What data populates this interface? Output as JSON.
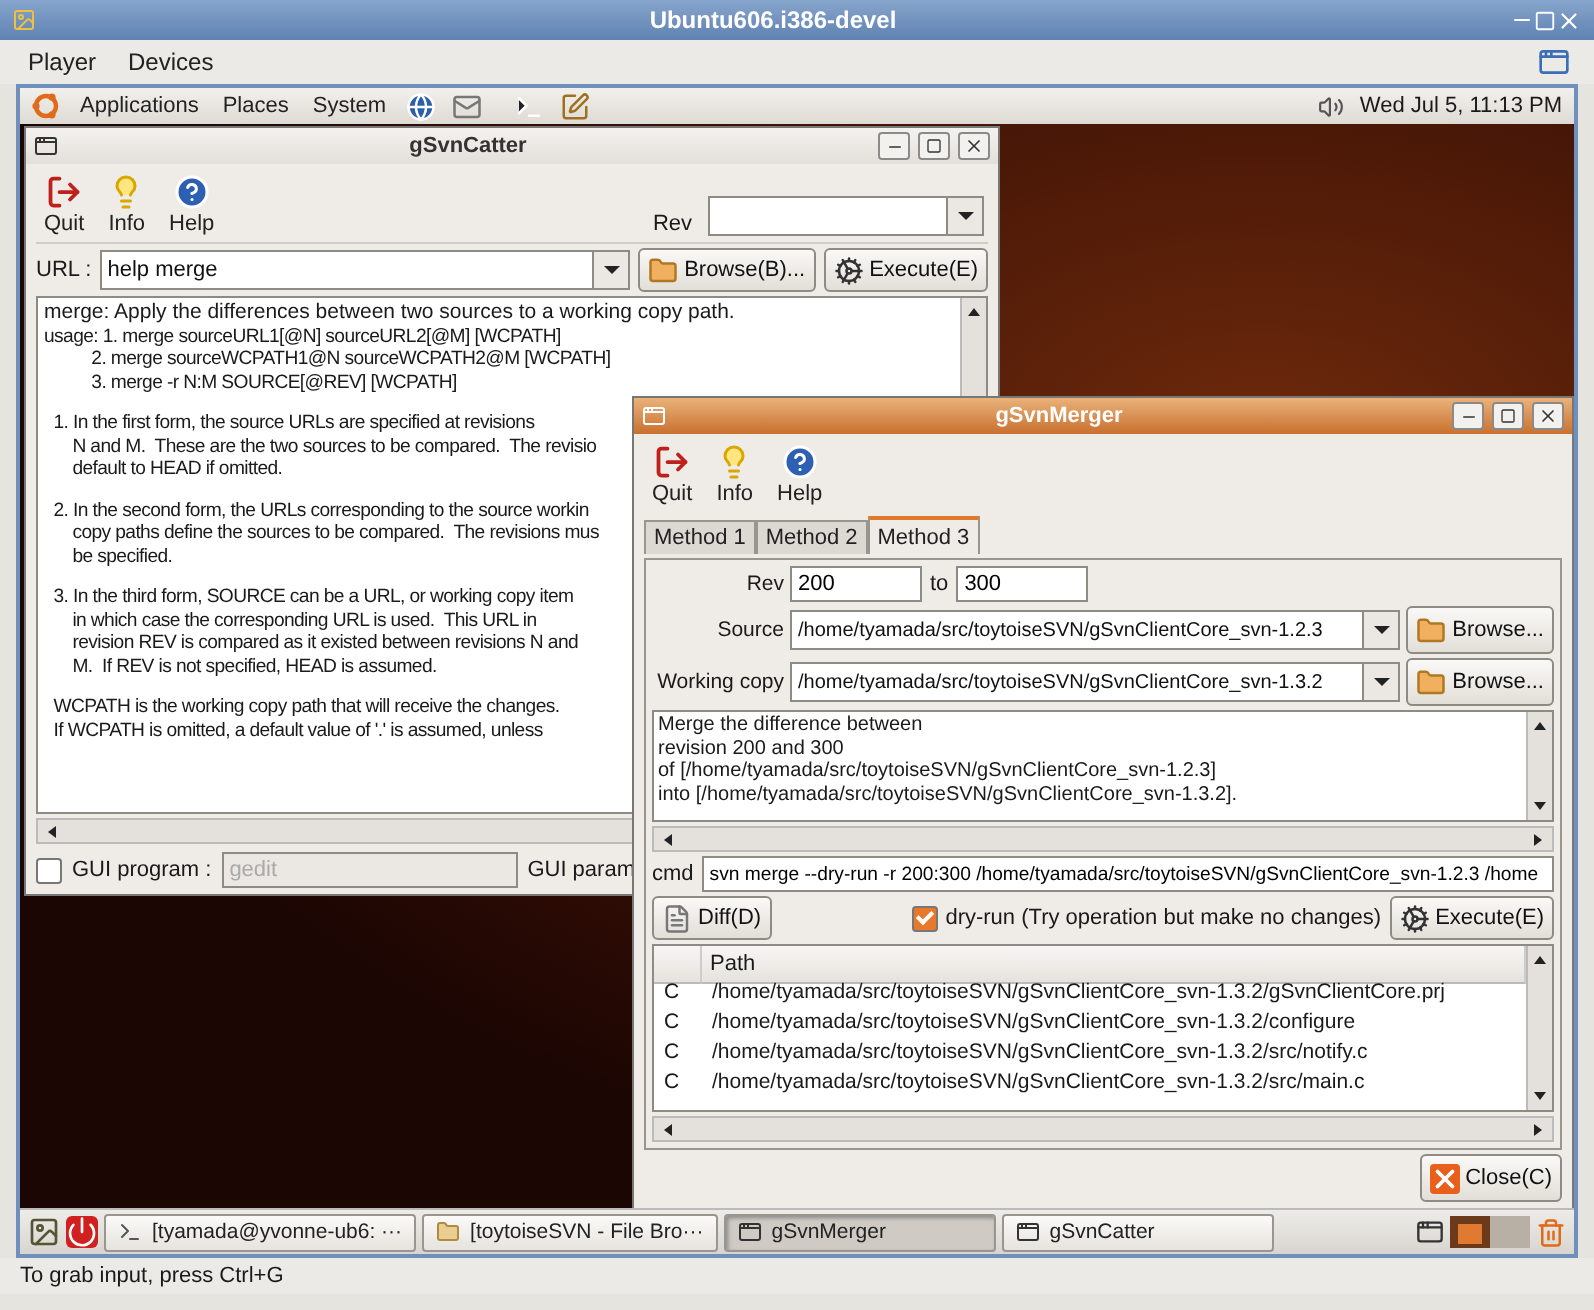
{
  "host": {
    "title": "Ubuntu606.i386-devel",
    "menus": [
      "Player",
      "Devices"
    ],
    "status": "To grab input, press Ctrl+G"
  },
  "top_panel": {
    "menus": [
      "Applications",
      "Places",
      "System"
    ],
    "clock": "Wed Jul  5, 11:13 PM"
  },
  "catter": {
    "title": "gSvnCatter",
    "focused": false,
    "toolbar": [
      {
        "kind": "quit",
        "label": "Quit"
      },
      {
        "kind": "info",
        "label": "Info"
      },
      {
        "kind": "help",
        "label": "Help"
      }
    ],
    "rev_label": "Rev",
    "url_label": "URL :",
    "url": "help merge",
    "browse": "Browse(B)...",
    "execute": "Execute(E)",
    "output": [
      [
        "merge: Apply the differences between two sources to a working copy path.",
        "usage: 1. merge sourceURL1[@N] sourceURL2[@M] [WCPATH]",
        "          2. merge sourceWCPATH1@N sourceWCPATH2@M [WCPATH]",
        "          3. merge -r N:M SOURCE[@REV] [WCPATH]"
      ],
      [
        "  1. In the first form, the source URLs are specified at revisions",
        "      N and M.  These are the two sources to be compared.  The revisio",
        "      default to HEAD if omitted."
      ],
      [
        "  2. In the second form, the URLs corresponding to the source workin",
        "      copy paths define the sources to be compared.  The revisions mus",
        "      be specified."
      ],
      [
        "  3. In the third form, SOURCE can be a URL, or working copy item",
        "      in which case the corresponding URL is used.  This URL in",
        "      revision REV is compared as it existed between revisions N and",
        "      M.  If REV is not specified, HEAD is assumed."
      ],
      [
        "  WCPATH is the working copy path that will receive the changes.",
        "  If WCPATH is omitted, a default value of '.' is assumed, unless"
      ]
    ],
    "gui_program": {
      "checked": false,
      "label": "GUI program :",
      "value": "gedit",
      "disabled": true
    },
    "gui_param": "GUI param"
  },
  "merger": {
    "title": "gSvnMerger",
    "focused": true,
    "toolbar": [
      {
        "kind": "quit",
        "label": "Quit"
      },
      {
        "kind": "info",
        "label": "Info"
      },
      {
        "kind": "help",
        "label": "Help"
      }
    ],
    "tabs": [
      {
        "label": "Method 1",
        "selected": false
      },
      {
        "label": "Method 2",
        "selected": false
      },
      {
        "label": "Method 3",
        "selected": true
      }
    ],
    "rev_label": "Rev",
    "rev_from": "200",
    "to_label": "to",
    "rev_to": "300",
    "source_label": "Source",
    "source": "/home/tyamada/src/toytoiseSVN/gSvnClientCore_svn-1.2.3",
    "source_browse": "Browse...",
    "working_copy_label": "Working copy",
    "working_copy": "/home/tyamada/src/toytoiseSVN/gSvnClientCore_svn-1.3.2",
    "working_copy_browse": "Browse...",
    "summary": [
      "Merge the difference between",
      "revision 200 and 300",
      "of [/home/tyamada/src/toytoiseSVN/gSvnClientCore_svn-1.2.3]",
      "into [/home/tyamada/src/toytoiseSVN/gSvnClientCore_svn-1.3.2]."
    ],
    "cmd_label": "cmd",
    "cmd": "svn merge --dry-run -r 200:300 /home/tyamada/src/toytoiseSVN/gSvnClientCore_svn-1.2.3 /home",
    "diff": "Diff(D)",
    "dry_run": {
      "checked": true,
      "label": "dry-run (Try operation but make no changes)"
    },
    "execute": "Execute(E)",
    "columns": [
      "Path"
    ],
    "rows": [
      {
        "status": "C",
        "path": "/home/tyamada/src/toytoiseSVN/gSvnClientCore_svn-1.3.2/gSvnClientCore.prj"
      },
      {
        "status": "C",
        "path": "/home/tyamada/src/toytoiseSVN/gSvnClientCore_svn-1.3.2/configure"
      },
      {
        "status": "C",
        "path": "/home/tyamada/src/toytoiseSVN/gSvnClientCore_svn-1.3.2/src/notify.c"
      },
      {
        "status": "C",
        "path": "/home/tyamada/src/toytoiseSVN/gSvnClientCore_svn-1.3.2/src/main.c"
      }
    ],
    "close": "Close(C)"
  },
  "taskbar": {
    "tasks": [
      {
        "kind": "terminal",
        "label": "[tyamada@yvonne-ub6: ···",
        "selected": false
      },
      {
        "kind": "folder",
        "label": "[toytoiseSVN - File Bro···",
        "selected": false
      },
      {
        "kind": "window",
        "label": "gSvnMerger",
        "selected": true
      },
      {
        "kind": "window",
        "label": "gSvnCatter",
        "selected": false
      }
    ]
  }
}
